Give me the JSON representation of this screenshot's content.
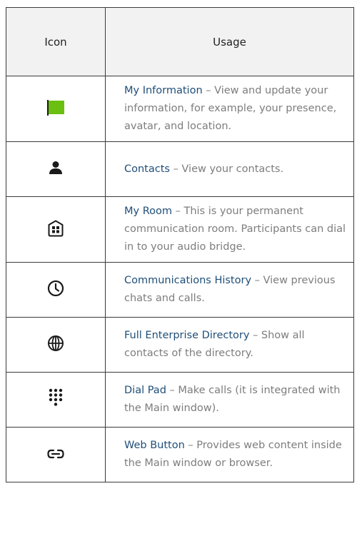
{
  "table": {
    "headers": {
      "icon": "Icon",
      "usage": "Usage"
    },
    "rows": [
      {
        "icon": "flag-icon",
        "title": "My Information",
        "text": " – View and update your information, for example, your presence, avatar, and location."
      },
      {
        "icon": "person-icon",
        "title": "Contacts",
        "text": " – View your contacts."
      },
      {
        "icon": "room-icon",
        "title": "My Room",
        "text": " – This is your permanent communication room. Participants can dial in to your audio bridge."
      },
      {
        "icon": "clock-icon",
        "title": "Communications History",
        "text": " – View previous chats and calls."
      },
      {
        "icon": "globe-icon",
        "title": "Full Enterprise Directory",
        "text": " – Show all contacts of the directory."
      },
      {
        "icon": "dialpad-icon",
        "title": "Dial Pad",
        "text": " – Make calls (it is integrated with the Main window)."
      },
      {
        "icon": "link-icon",
        "title": "Web Button",
        "text": " – Provides web content inside the Main window or browser."
      }
    ]
  },
  "colors": {
    "flag": "#6abf10",
    "title": "#1f4e79",
    "body": "#7d7d7d",
    "icon": "#1a1a1a"
  }
}
